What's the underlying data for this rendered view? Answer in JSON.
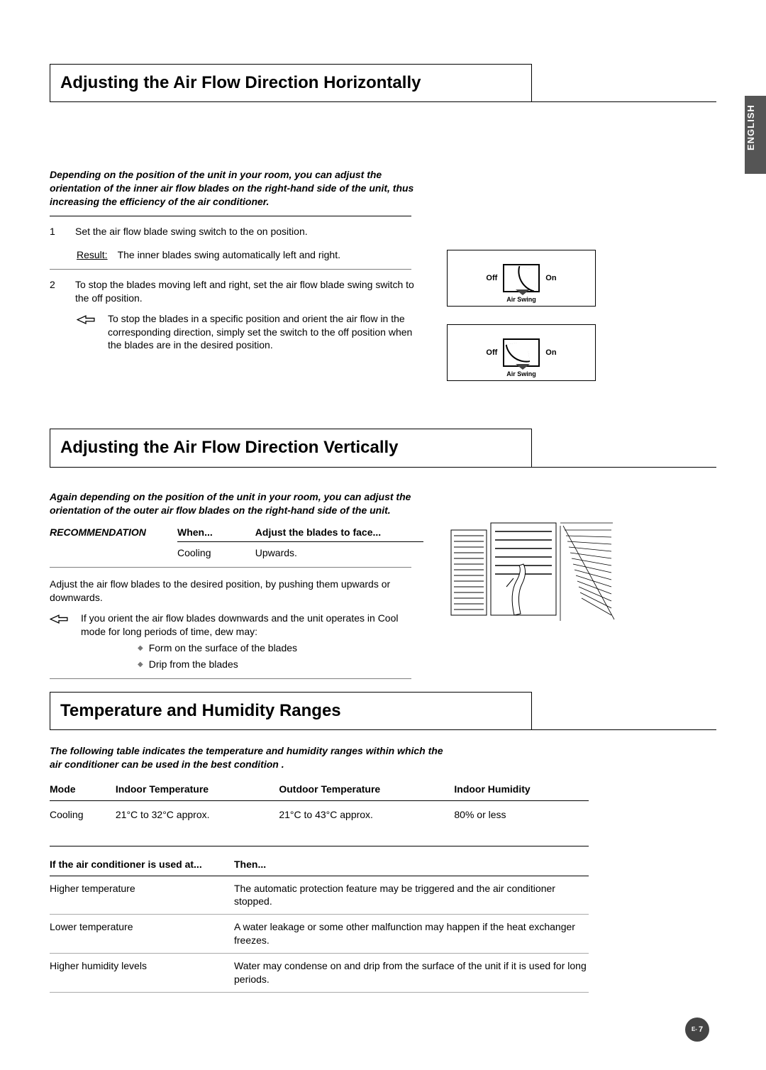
{
  "language_tab": "ENGLISH",
  "sections": {
    "horizontal": {
      "title": "Adjusting the Air Flow Direction Horizontally",
      "intro": "Depending on the position of the unit in your room, you can adjust the orientation of the inner air flow blades on the right-hand side of the unit, thus increasing the efficiency of the air conditioner.",
      "step1_num": "1",
      "step1_text": "Set the air flow blade swing switch to the on position.",
      "result_label": "Result:",
      "result_text": "The inner blades swing automatically left and right.",
      "step2_num": "2",
      "step2_text": "To stop the blades moving left and right, set the air flow blade swing switch to the off position.",
      "note_text": "To stop the blades in a specific position and orient the air flow in the corresponding direction, simply set the switch to the off position when the blades are in the desired position.",
      "switch_off": "Off",
      "switch_on": "On",
      "switch_sub": "Air Swing"
    },
    "vertical": {
      "title": "Adjusting the Air Flow Direction Vertically",
      "intro": "Again depending on the position of the unit in your room, you can adjust the orientation of the outer air flow blades on the right-hand side of the unit.",
      "rec_label": "RECOMMENDATION",
      "th_when": "When...",
      "th_adjust": "Adjust the blades to face...",
      "rec_when": "Cooling",
      "rec_adjust": "Upwards.",
      "adjust_text": "Adjust the air flow blades to the desired position, by pushing them upwards or downwards.",
      "note_text": "If you orient the air flow blades downwards and the unit operates in Cool mode for long periods of time, dew may:",
      "sub1": "Form on the surface of the blades",
      "sub2": "Drip from the blades"
    },
    "temp": {
      "title": "Temperature and Humidity Ranges",
      "intro": "The following table indicates the temperature and humidity ranges within which the air conditioner can be used in the best condition .",
      "th_mode": "Mode",
      "th_indoor_t": "Indoor Temperature",
      "th_outdoor_t": "Outdoor Temperature",
      "th_indoor_h": "Indoor Humidity",
      "row_mode": "Cooling",
      "row_indoor_t": "21°C to 32°C approx.",
      "row_outdoor_t": "21°C to 43°C approx.",
      "row_indoor_h": "80% or less",
      "cond_th1": "If the air conditioner is used at...",
      "cond_th2": "Then...",
      "c1a": "Higher temperature",
      "c1b": "The automatic protection feature may be triggered and the air conditioner stopped.",
      "c2a": "Lower temperature",
      "c2b": "A water leakage or some other malfunction may happen if the heat exchanger freezes.",
      "c3a": "Higher humidity levels",
      "c3b": "Water may condense on and drip from the surface of the unit if it is used for long periods."
    }
  },
  "page": {
    "prefix": "E-",
    "num": "7"
  }
}
